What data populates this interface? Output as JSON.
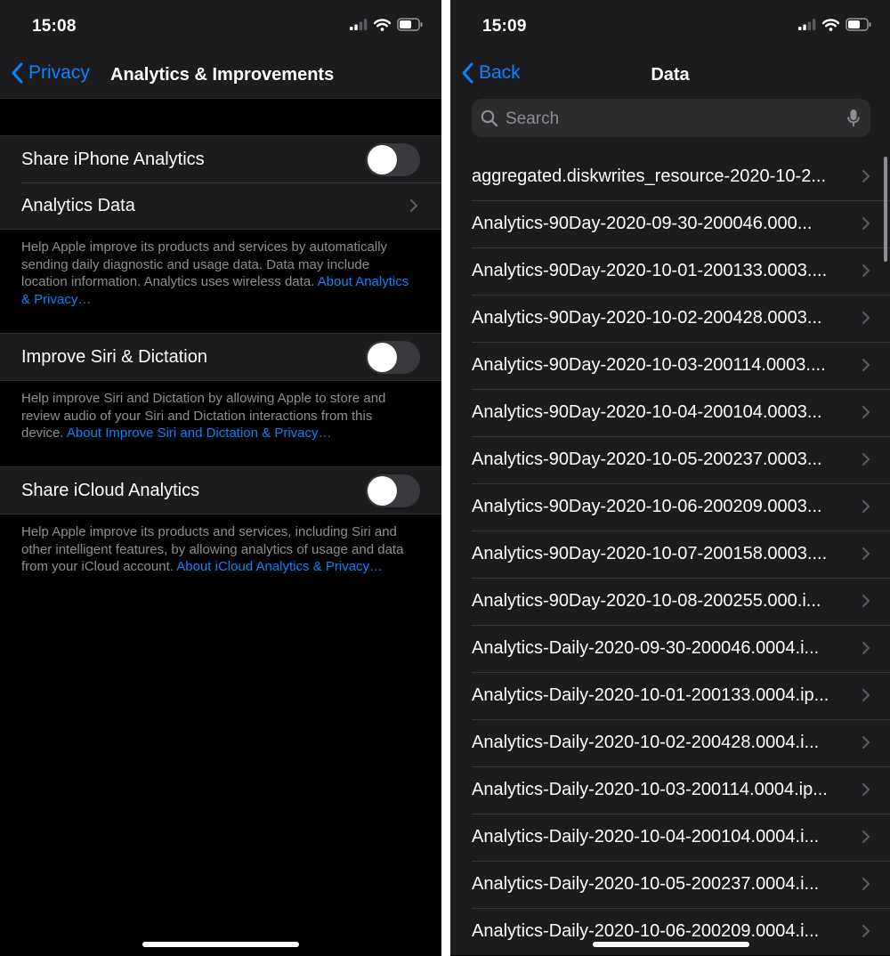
{
  "left": {
    "status": {
      "time": "15:08"
    },
    "nav": {
      "back_label": "Privacy",
      "title": "Analytics & Improvements"
    },
    "share_iphone": {
      "label": "Share iPhone Analytics"
    },
    "analytics_data": {
      "label": "Analytics Data"
    },
    "footer1": {
      "text": "Help Apple improve its products and services by automatically sending daily diagnostic and usage data. Data may include location information. Analytics uses wireless data. ",
      "link": "About Analytics & Privacy…"
    },
    "siri": {
      "label": "Improve Siri & Dictation"
    },
    "footer2": {
      "text": "Help improve Siri and Dictation by allowing Apple to store and review audio of your Siri and Dictation interactions from this device. ",
      "link": "About Improve Siri and Dictation & Privacy…"
    },
    "icloud": {
      "label": "Share iCloud Analytics"
    },
    "footer3": {
      "text": "Help Apple improve its products and services, including Siri and other intelligent features, by allowing analytics of usage and data from your iCloud account. ",
      "link": "About iCloud Analytics & Privacy…"
    }
  },
  "right": {
    "status": {
      "time": "15:09"
    },
    "nav": {
      "back_label": "Back",
      "title": "Data"
    },
    "search": {
      "placeholder": "Search"
    },
    "files": [
      "aggregated.diskwrites_resource-2020-10-2...",
      "Analytics-90Day-2020-09-30-200046.000...",
      "Analytics-90Day-2020-10-01-200133.0003....",
      "Analytics-90Day-2020-10-02-200428.0003...",
      "Analytics-90Day-2020-10-03-200114.0003....",
      "Analytics-90Day-2020-10-04-200104.0003...",
      "Analytics-90Day-2020-10-05-200237.0003...",
      "Analytics-90Day-2020-10-06-200209.0003...",
      "Analytics-90Day-2020-10-07-200158.0003....",
      "Analytics-90Day-2020-10-08-200255.000.i...",
      "Analytics-Daily-2020-09-30-200046.0004.i...",
      "Analytics-Daily-2020-10-01-200133.0004.ip...",
      "Analytics-Daily-2020-10-02-200428.0004.i...",
      "Analytics-Daily-2020-10-03-200114.0004.ip...",
      "Analytics-Daily-2020-10-04-200104.0004.i...",
      "Analytics-Daily-2020-10-05-200237.0004.i...",
      "Analytics-Daily-2020-10-06-200209.0004.i..."
    ]
  },
  "colors": {
    "accent": "#0a84ff",
    "background": "#000000",
    "cell": "#1c1c1e",
    "secondary_text": "#8e8e93"
  }
}
